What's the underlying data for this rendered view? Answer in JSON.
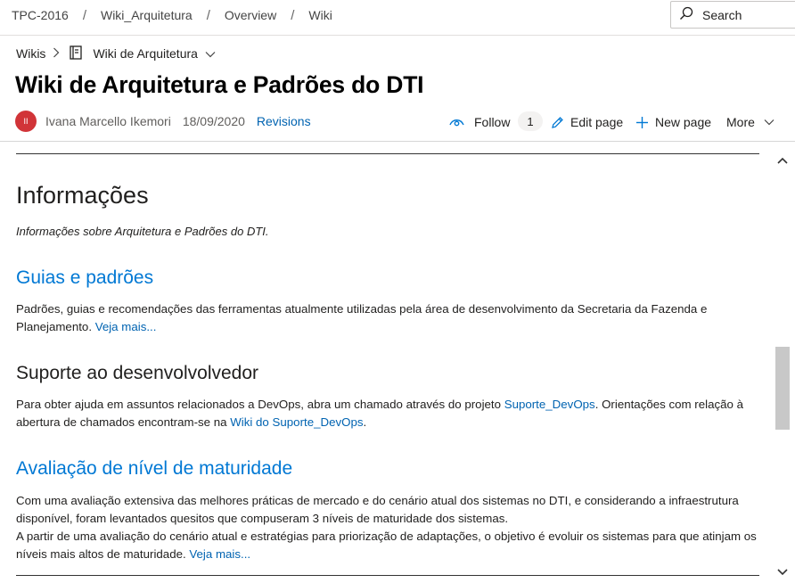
{
  "breadcrumb": {
    "items": [
      "TPC-2016",
      "Wiki_Arquitetura",
      "Overview",
      "Wiki"
    ],
    "separator": "/"
  },
  "search": {
    "placeholder": "Search"
  },
  "wiki_nav": {
    "root": "Wikis",
    "current": "Wiki de Arquitetura"
  },
  "page": {
    "title": "Wiki de Arquitetura e Padrões do DTI",
    "author_initials": "II",
    "author": "Ivana Marcello Ikemori",
    "date": "18/09/2020",
    "revisions": "Revisions"
  },
  "actions": {
    "follow": "Follow",
    "follow_count": "1",
    "edit": "Edit page",
    "new": "New page",
    "more": "More"
  },
  "content": {
    "heading": "Informações",
    "intro": "Informações sobre Arquitetura e Padrões do DTI.",
    "sections": [
      {
        "title": "Guias e padrões",
        "text": "Padrões, guias e recomendações das ferramentas atualmente utilizadas pela área de desenvolvimento da Secretaria da Fazenda e Planejamento. ",
        "link": "Veja mais..."
      },
      {
        "title": "Suporte ao desenvolvolvedor",
        "text_1": "Para obter ajuda em assuntos relacionados a DevOps, abra um chamado através do projeto ",
        "link_1": "Suporte_DevOps",
        "text_2": ". Orientações com relação à abertura de chamados encontram-se na ",
        "link_2": "Wiki do Suporte_DevOps",
        "text_3": "."
      },
      {
        "title": "Avaliação de nível de maturidade",
        "text_1": "Com uma avaliação extensiva das melhores práticas de mercado e do cenário atual dos sistemas no DTI, e considerando a infraestrutura disponível, foram levantados quesitos que compuseram 3 níveis de maturidade dos sistemas.",
        "text_2": "A partir de uma avaliação do cenário atual e estratégias para priorização de adaptações, o objetivo é evoluir os sistemas para que atinjam os níveis mais altos de maturidade. ",
        "link": "Veja mais..."
      }
    ]
  },
  "colors": {
    "link": "#0078d4",
    "avatar": "#d13438",
    "badge_bg": "#f3f2f1"
  }
}
